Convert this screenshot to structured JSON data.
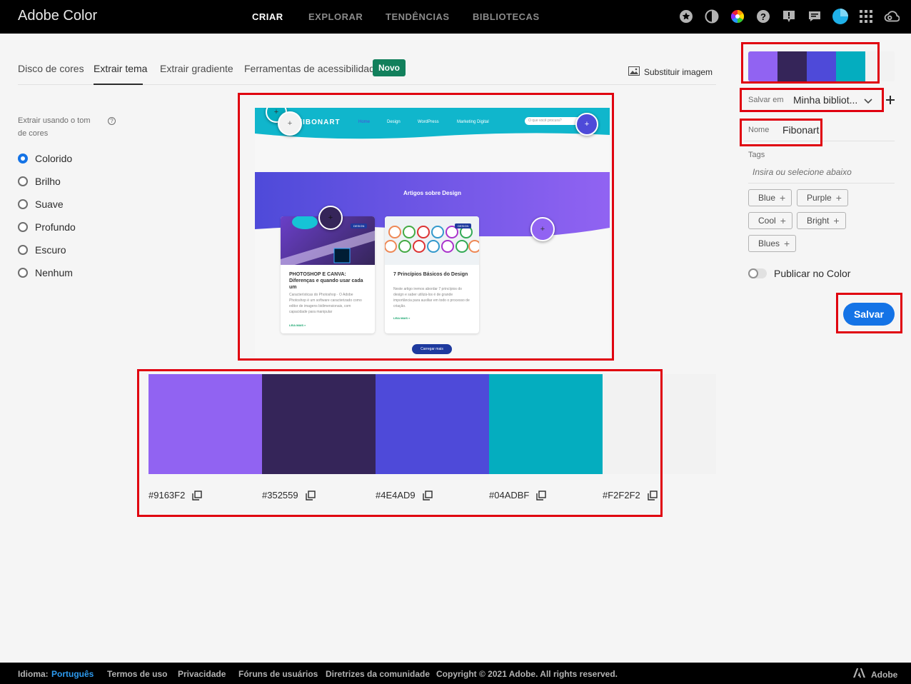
{
  "app": {
    "brand": "Adobe Color",
    "nav": [
      "CRIAR",
      "EXPLORAR",
      "TENDÊNCIAS",
      "BIBLIOTECAS"
    ]
  },
  "tabs": {
    "items": [
      "Disco de cores",
      "Extrair tema",
      "Extrair gradiente",
      "Ferramentas de acessibilidade"
    ],
    "active": "Extrair tema",
    "badge": "Novo",
    "replace_image": "Substituir imagem"
  },
  "mood": {
    "label": "Extrair usando o tom de cores",
    "help": "?",
    "options": [
      "Colorido",
      "Brilho",
      "Suave",
      "Profundo",
      "Escuro",
      "Nenhum"
    ],
    "selected": "Colorido"
  },
  "preview": {
    "logo": "FIBONART",
    "menu": [
      "Home",
      "Design",
      "WordPress",
      "Marketing Digital"
    ],
    "search_placeholder": "O que você procura?",
    "hero_title": "Artigos sobre Design",
    "cards": [
      {
        "badge": "DESIGN",
        "title": "PHOTOSHOP E CANVA: Diferenças e quando usar cada um",
        "text": "Características do Photoshop · O Adobe Photoshop é um software caracterizado como editor de imagens bidimensionais, com capacidade para manipular",
        "link": "LEIA MAIS »"
      },
      {
        "badge": "DESIGN",
        "title": "7 Princípios Básicos do Design",
        "text": "Neste artigo iremos abordar 7 princípios do design e saber utilizá-los é de grande importância para auxiliar em todo o processo de criação.",
        "link": "LEIA MAIS »"
      }
    ],
    "load_more": "Carregar mais"
  },
  "palette": [
    {
      "hex": "#9163F2"
    },
    {
      "hex": "#352559"
    },
    {
      "hex": "#4E4AD9"
    },
    {
      "hex": "#04ADBF"
    },
    {
      "hex": "#F2F2F2"
    }
  ],
  "save_panel": {
    "save_in_label": "Salvar em",
    "save_in_value": "Minha bibliot...",
    "name_label": "Nome",
    "name_value": "Fibonart",
    "tags_label": "Tags",
    "tags_placeholder": "Insira ou selecione abaixo",
    "tags": [
      "Blue",
      "Purple",
      "Cool",
      "Bright",
      "Blues"
    ],
    "publish_label": "Publicar no Color",
    "publish_on": false,
    "save_button": "Salvar"
  },
  "footer": {
    "language_label": "Idioma:",
    "language_value": "Português",
    "links": [
      "Termos de uso",
      "Privacidade",
      "Fóruns de usuários",
      "Diretrizes da comunidade"
    ],
    "copyright": "Copyright © 2021 Adobe. All rights reserved.",
    "adobe": "Adobe"
  },
  "colors": {
    "accent": "#1473e6",
    "badge": "#12805c",
    "highlight": "#e0000f"
  },
  "icons": [
    "star-icon",
    "contrast-icon",
    "color-wheel-icon",
    "help-icon",
    "alert-icon",
    "chat-icon",
    "user-avatar",
    "apps-grid-icon",
    "creative-cloud-icon",
    "image-icon",
    "chevron-down-icon",
    "plus-icon",
    "copy-icon",
    "adobe-logo-icon"
  ]
}
